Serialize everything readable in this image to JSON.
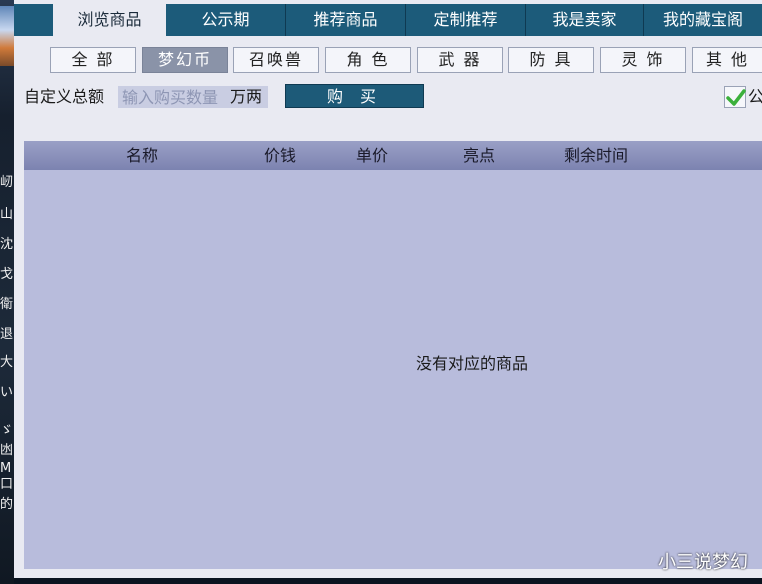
{
  "left_strip_glyphs": [
    "屻",
    "山",
    "沈",
    "戈",
    "衛",
    "退",
    "大",
    "いる",
    "ゞ",
    "凼",
    "M",
    "口",
    "的"
  ],
  "tabs": [
    {
      "label": "浏览商品"
    },
    {
      "label": "公示期"
    },
    {
      "label": "推荐商品"
    },
    {
      "label": "定制推荐"
    },
    {
      "label": "我是卖家"
    },
    {
      "label": "我的藏宝阁"
    }
  ],
  "categories": [
    {
      "label": "全 部"
    },
    {
      "label": "梦幻币"
    },
    {
      "label": "召唤兽"
    },
    {
      "label": "角 色"
    },
    {
      "label": "武 器"
    },
    {
      "label": "防 具"
    },
    {
      "label": "灵 饰"
    },
    {
      "label": "其 他"
    }
  ],
  "custom_amount": {
    "label": "自定义总额",
    "placeholder": "输入购买数量",
    "unit": "万两",
    "buy_label": "购 买",
    "checkbox_label": "公"
  },
  "table": {
    "columns": [
      "名称",
      "价钱",
      "单价",
      "亮点",
      "剩余时间"
    ],
    "empty_message": "没有对应的商品"
  },
  "watermark": "小三说梦幻",
  "colors": {
    "tab_bar": "#1c5b7a",
    "panel_bg": "#e9eaf2",
    "table_bg": "#b8bcdc",
    "header_bg": "#7c83b0",
    "active_category": "#8a93a8",
    "check_green": "#3bb03b"
  }
}
